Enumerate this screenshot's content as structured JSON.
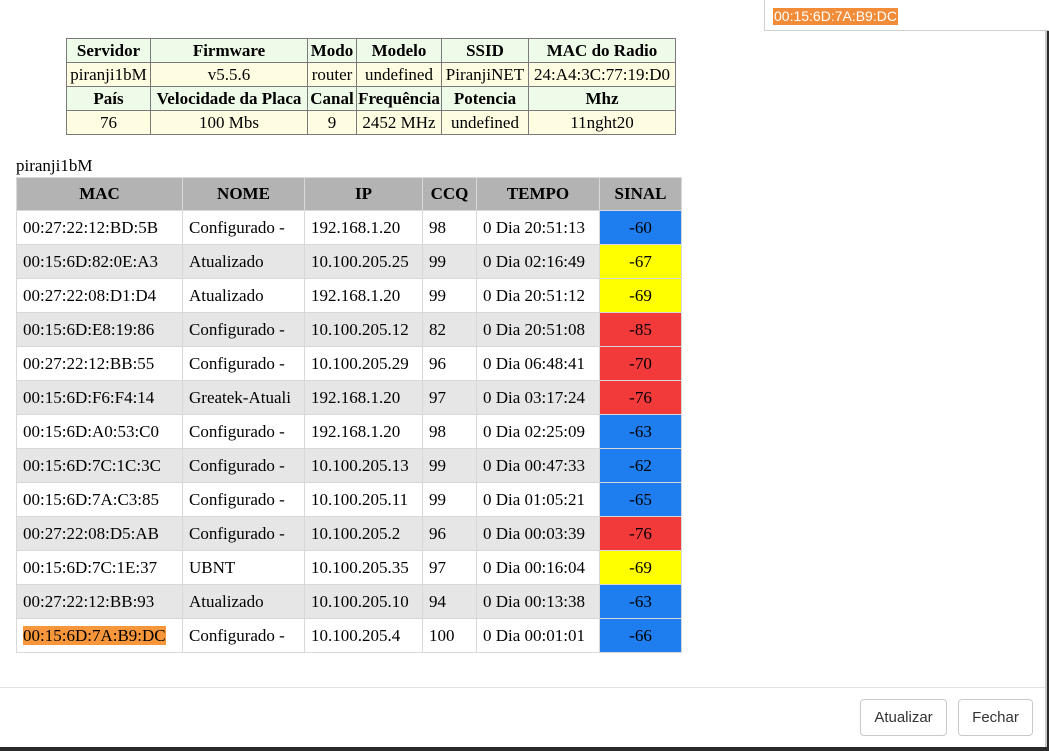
{
  "find": {
    "query": "00:15:6D:7A:B9:DC"
  },
  "info": {
    "headers1": [
      "Servidor",
      "Firmware",
      "Modo",
      "Modelo",
      "SSID",
      "MAC do Radio"
    ],
    "values1": [
      "piranji1bM",
      "v5.5.6",
      "router",
      "undefined",
      "PiranjiNET",
      "24:A4:3C:77:19:D0"
    ],
    "headers2": [
      "País",
      "Velocidade da Placa",
      "Canal",
      "Frequência",
      "Potencia",
      "Mhz"
    ],
    "values2": [
      "76",
      "100 Mbs",
      "9",
      "2452 MHz",
      "undefined",
      "11nght20"
    ]
  },
  "server_label": "piranji1bM",
  "clients": {
    "headers": [
      "MAC",
      "NOME",
      "IP",
      "CCQ",
      "TEMPO",
      "SINAL"
    ],
    "rows": [
      {
        "mac": "00:27:22:12:BD:5B",
        "nome": "Configurado -",
        "ip": "192.168.1.20",
        "ccq": "98",
        "tempo": "0 Dia 20:51:13",
        "sinal": "-60",
        "color": "blue"
      },
      {
        "mac": "00:15:6D:82:0E:A3",
        "nome": "Atualizado",
        "ip": "10.100.205.25",
        "ccq": "99",
        "tempo": "0 Dia 02:16:49",
        "sinal": "-67",
        "color": "yellow"
      },
      {
        "mac": "00:27:22:08:D1:D4",
        "nome": "Atualizado",
        "ip": "192.168.1.20",
        "ccq": "99",
        "tempo": "0 Dia 20:51:12",
        "sinal": "-69",
        "color": "yellow"
      },
      {
        "mac": "00:15:6D:E8:19:86",
        "nome": "Configurado -",
        "ip": "10.100.205.12",
        "ccq": "82",
        "tempo": "0 Dia 20:51:08",
        "sinal": "-85",
        "color": "red"
      },
      {
        "mac": "00:27:22:12:BB:55",
        "nome": "Configurado -",
        "ip": "10.100.205.29",
        "ccq": "96",
        "tempo": "0 Dia 06:48:41",
        "sinal": "-70",
        "color": "red"
      },
      {
        "mac": "00:15:6D:F6:F4:14",
        "nome": "Greatek-Atuali",
        "ip": "192.168.1.20",
        "ccq": "97",
        "tempo": "0 Dia 03:17:24",
        "sinal": "-76",
        "color": "red"
      },
      {
        "mac": "00:15:6D:A0:53:C0",
        "nome": "Configurado -",
        "ip": "192.168.1.20",
        "ccq": "98",
        "tempo": "0 Dia 02:25:09",
        "sinal": "-63",
        "color": "blue"
      },
      {
        "mac": "00:15:6D:7C:1C:3C",
        "nome": "Configurado -",
        "ip": "10.100.205.13",
        "ccq": "99",
        "tempo": "0 Dia 00:47:33",
        "sinal": "-62",
        "color": "blue"
      },
      {
        "mac": "00:15:6D:7A:C3:85",
        "nome": "Configurado -",
        "ip": "10.100.205.11",
        "ccq": "99",
        "tempo": "0 Dia 01:05:21",
        "sinal": "-65",
        "color": "blue"
      },
      {
        "mac": "00:27:22:08:D5:AB",
        "nome": "Configurado -",
        "ip": "10.100.205.2",
        "ccq": "96",
        "tempo": "0 Dia 00:03:39",
        "sinal": "-76",
        "color": "red"
      },
      {
        "mac": "00:15:6D:7C:1E:37",
        "nome": "UBNT",
        "ip": "10.100.205.35",
        "ccq": "97",
        "tempo": "0 Dia 00:16:04",
        "sinal": "-69",
        "color": "yellow"
      },
      {
        "mac": "00:27:22:12:BB:93",
        "nome": "Atualizado",
        "ip": "10.100.205.10",
        "ccq": "94",
        "tempo": "0 Dia 00:13:38",
        "sinal": "-63",
        "color": "blue"
      },
      {
        "mac": "00:15:6D:7A:B9:DC",
        "nome": "Configurado -",
        "ip": "10.100.205.4",
        "ccq": "100",
        "tempo": "0 Dia 00:01:01",
        "sinal": "-66",
        "color": "blue",
        "highlight": true
      }
    ]
  },
  "colors": {
    "blue": "#1e7ef0",
    "yellow": "#ffff00",
    "red": "#f23a3a",
    "highlight": "#f7963a"
  },
  "buttons": {
    "refresh": "Atualizar",
    "close": "Fechar"
  }
}
